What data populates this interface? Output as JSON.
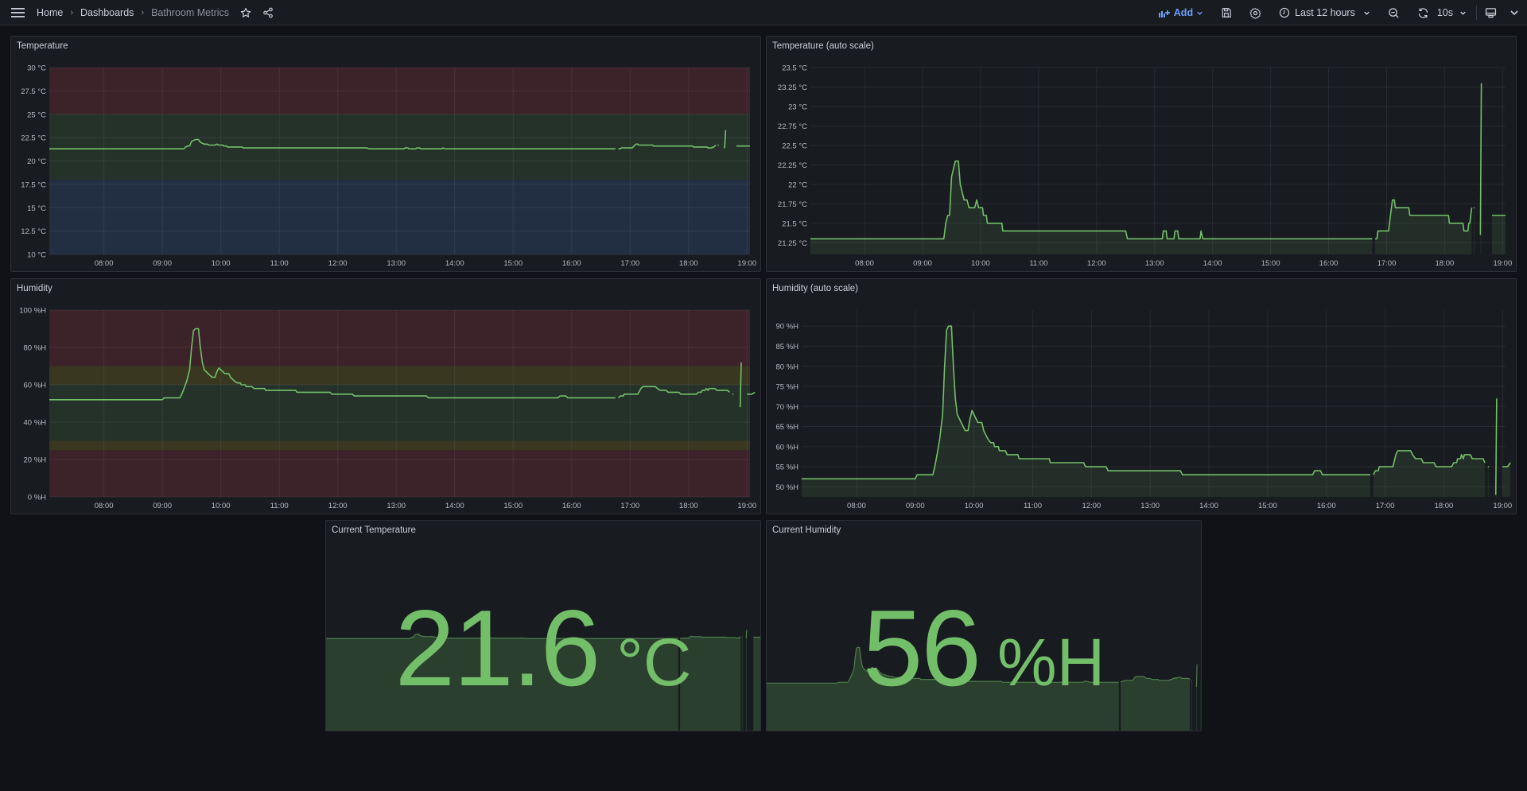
{
  "topbar": {
    "menu_icon": "hamburger-icon",
    "breadcrumbs": [
      "Home",
      "Dashboards",
      "Bathroom Metrics"
    ],
    "star_icon": "star-icon",
    "share_icon": "share-icon",
    "add_label": "Add",
    "save_icon": "save-icon",
    "settings_icon": "gear-icon",
    "time_range": "Last 12 hours",
    "zoom_out_icon": "zoom-out-icon",
    "refresh_icon": "refresh-icon",
    "refresh_interval": "10s",
    "tv_mode_icon": "monitor-icon"
  },
  "colors": {
    "accent": "#6e9fff",
    "series_green": "#73bf69",
    "threshold_red": "#f2495c",
    "threshold_green": "#73bf69",
    "threshold_blue": "#5794f2",
    "threshold_yellow": "#fade2a"
  },
  "panels": {
    "temperature": {
      "title": "Temperature"
    },
    "temperature_auto": {
      "title": "Temperature (auto scale)"
    },
    "humidity": {
      "title": "Humidity"
    },
    "humidity_auto": {
      "title": "Humidity (auto scale)"
    },
    "current_temperature": {
      "title": "Current Temperature",
      "value": "21.6",
      "unit": "°C"
    },
    "current_humidity": {
      "title": "Current Humidity",
      "value": "56",
      "unit": "%H"
    }
  },
  "chart_data": [
    {
      "id": "temperature",
      "type": "line",
      "title": "Temperature",
      "unit": "°C",
      "ylim": [
        10,
        30
      ],
      "yticks": [
        10,
        12.5,
        15,
        17.5,
        20,
        22.5,
        25,
        27.5,
        30
      ],
      "ytick_labels": [
        "10 °C",
        "12.5 °C",
        "15 °C",
        "17.5 °C",
        "20 °C",
        "22.5 °C",
        "25 °C",
        "27.5 °C",
        "30 °C"
      ],
      "xlim_minutes": [
        424,
        1143
      ],
      "xticks": [
        "08:00",
        "09:00",
        "10:00",
        "11:00",
        "12:00",
        "13:00",
        "14:00",
        "15:00",
        "16:00",
        "17:00",
        "18:00",
        "19:00"
      ],
      "thresholds": [
        {
          "from": 25,
          "to": 30,
          "color": "red"
        },
        {
          "from": 18,
          "to": 25,
          "color": "green"
        },
        {
          "from": 10,
          "to": 18,
          "color": "blue"
        }
      ],
      "series": "temperature",
      "fill": false,
      "grid": true
    },
    {
      "id": "temperature_auto",
      "type": "area",
      "title": "Temperature (auto scale)",
      "unit": "°C",
      "ylim": [
        21.1,
        23.5
      ],
      "yticks": [
        21.25,
        21.5,
        21.75,
        22,
        22.25,
        22.5,
        22.75,
        23,
        23.25,
        23.5
      ],
      "ytick_labels": [
        "21.25 °C",
        "21.5 °C",
        "21.75 °C",
        "22 °C",
        "22.25 °C",
        "22.5 °C",
        "22.75 °C",
        "23 °C",
        "23.25 °C",
        "23.5 °C"
      ],
      "xlim_minutes": [
        424,
        1143
      ],
      "xticks": [
        "08:00",
        "09:00",
        "10:00",
        "11:00",
        "12:00",
        "13:00",
        "14:00",
        "15:00",
        "16:00",
        "17:00",
        "18:00",
        "19:00"
      ],
      "series": "temperature",
      "fill": true,
      "grid": true
    },
    {
      "id": "humidity",
      "type": "line",
      "title": "Humidity",
      "unit": "%H",
      "ylim": [
        0,
        100
      ],
      "yticks": [
        0,
        20,
        40,
        60,
        80,
        100
      ],
      "ytick_labels": [
        "0 %H",
        "20 %H",
        "40 %H",
        "60 %H",
        "80 %H",
        "100 %H"
      ],
      "xlim_minutes": [
        424,
        1143
      ],
      "xticks": [
        "08:00",
        "09:00",
        "10:00",
        "11:00",
        "12:00",
        "13:00",
        "14:00",
        "15:00",
        "16:00",
        "17:00",
        "18:00",
        "19:00"
      ],
      "thresholds": [
        {
          "from": 70,
          "to": 100,
          "color": "red"
        },
        {
          "from": 60,
          "to": 70,
          "color": "yellow"
        },
        {
          "from": 30,
          "to": 60,
          "color": "green"
        },
        {
          "from": 25,
          "to": 30,
          "color": "yellow"
        },
        {
          "from": 0,
          "to": 25,
          "color": "red"
        }
      ],
      "series": "humidity",
      "fill": false,
      "grid": true
    },
    {
      "id": "humidity_auto",
      "type": "area",
      "title": "Humidity (auto scale)",
      "unit": "%H",
      "ylim": [
        47.5,
        94
      ],
      "yticks": [
        50,
        55,
        60,
        65,
        70,
        75,
        80,
        85,
        90
      ],
      "ytick_labels": [
        "50 %H",
        "55 %H",
        "60 %H",
        "65 %H",
        "70 %H",
        "75 %H",
        "80 %H",
        "85 %H",
        "90 %H"
      ],
      "xlim_minutes": [
        424,
        1143
      ],
      "xticks": [
        "08:00",
        "09:00",
        "10:00",
        "11:00",
        "12:00",
        "13:00",
        "14:00",
        "15:00",
        "16:00",
        "17:00",
        "18:00",
        "19:00"
      ],
      "series": "humidity",
      "fill": true,
      "grid": true
    },
    {
      "id": "current_temperature_spark",
      "type": "area",
      "series": "temperature",
      "ylim": [
        0,
        30
      ],
      "last_value": 21.6
    },
    {
      "id": "current_humidity_spark",
      "type": "area",
      "series": "humidity",
      "ylim": [
        0,
        140
      ],
      "last_value": 56
    }
  ],
  "series_data": {
    "temperature": [
      [
        [
          424,
          21.3
        ],
        [
          562,
          21.3
        ],
        [
          564,
          21.5
        ],
        [
          566,
          21.6
        ],
        [
          568,
          21.6
        ],
        [
          570,
          22.1
        ],
        [
          572,
          22.2
        ],
        [
          574,
          22.3
        ],
        [
          577,
          22.3
        ],
        [
          579,
          22.0
        ],
        [
          581,
          21.9
        ],
        [
          583,
          21.8
        ],
        [
          586,
          21.8
        ],
        [
          588,
          21.7
        ],
        [
          594,
          21.7
        ],
        [
          596,
          21.8
        ],
        [
          598,
          21.7
        ],
        [
          602,
          21.7
        ],
        [
          603,
          21.6
        ],
        [
          606,
          21.6
        ],
        [
          607,
          21.5
        ],
        [
          622,
          21.5
        ],
        [
          623,
          21.4
        ],
        [
          750,
          21.4
        ],
        [
          752,
          21.3
        ],
        [
          788,
          21.3
        ],
        [
          789,
          21.4
        ],
        [
          792,
          21.4
        ],
        [
          793,
          21.3
        ],
        [
          800,
          21.3
        ],
        [
          801,
          21.4
        ],
        [
          804,
          21.4
        ],
        [
          805,
          21.3
        ],
        [
          827,
          21.3
        ],
        [
          828,
          21.4
        ],
        [
          830,
          21.3
        ],
        [
          1005,
          21.3
        ]
      ],
      [
        [
          1008,
          21.3
        ],
        [
          1010,
          21.3
        ],
        [
          1011,
          21.4
        ],
        [
          1022,
          21.4
        ],
        [
          1023,
          21.5
        ],
        [
          1026,
          21.8
        ],
        [
          1028,
          21.8
        ],
        [
          1029,
          21.7
        ],
        [
          1043,
          21.7
        ],
        [
          1044,
          21.6
        ],
        [
          1084,
          21.6
        ],
        [
          1085,
          21.5
        ],
        [
          1099,
          21.5
        ],
        [
          1100,
          21.4
        ],
        [
          1104,
          21.4
        ],
        [
          1105,
          21.5
        ],
        [
          1106,
          21.5
        ],
        [
          1108,
          21.7
        ]
      ],
      [
        [
          1110,
          21.7
        ],
        [
          1111,
          21.7
        ]
      ],
      [
        [
          1117,
          21.35
        ],
        [
          1118,
          23.3
        ]
      ],
      [
        [
          1129,
          21.6
        ],
        [
          1143,
          21.6
        ]
      ]
    ],
    "humidity": [
      [
        [
          424,
          52
        ],
        [
          540,
          52
        ],
        [
          542,
          53
        ],
        [
          558,
          53
        ],
        [
          560,
          55
        ],
        [
          563,
          59
        ],
        [
          565,
          62
        ],
        [
          568,
          68
        ],
        [
          570,
          80
        ],
        [
          572,
          89
        ],
        [
          574,
          90
        ],
        [
          577,
          90
        ],
        [
          579,
          80
        ],
        [
          581,
          72
        ],
        [
          583,
          68
        ],
        [
          585,
          67
        ],
        [
          587,
          66
        ],
        [
          589,
          65
        ],
        [
          591,
          64
        ],
        [
          594,
          64
        ],
        [
          596,
          67
        ],
        [
          598,
          69
        ],
        [
          600,
          68
        ],
        [
          602,
          67
        ],
        [
          604,
          66
        ],
        [
          608,
          66
        ],
        [
          610,
          64
        ],
        [
          612,
          63
        ],
        [
          614,
          62
        ],
        [
          617,
          61
        ],
        [
          620,
          61
        ],
        [
          621,
          60
        ],
        [
          625,
          60
        ],
        [
          626,
          59
        ],
        [
          632,
          59
        ],
        [
          634,
          58
        ],
        [
          645,
          58
        ],
        [
          646,
          57
        ],
        [
          677,
          57
        ],
        [
          678,
          56
        ],
        [
          712,
          56
        ],
        [
          714,
          55
        ],
        [
          735,
          55
        ],
        [
          737,
          54
        ],
        [
          811,
          54
        ],
        [
          813,
          53
        ],
        [
          946,
          53
        ],
        [
          948,
          54
        ],
        [
          954,
          54
        ],
        [
          956,
          53
        ],
        [
          1005,
          53
        ]
      ],
      [
        [
          1008,
          53
        ],
        [
          1010,
          54
        ],
        [
          1013,
          54
        ],
        [
          1014,
          55
        ],
        [
          1028,
          55
        ],
        [
          1029,
          56
        ],
        [
          1031,
          58
        ],
        [
          1033,
          59
        ],
        [
          1046,
          59
        ],
        [
          1048,
          58
        ],
        [
          1051,
          57
        ],
        [
          1057,
          57
        ],
        [
          1059,
          56
        ],
        [
          1070,
          56
        ],
        [
          1072,
          55
        ],
        [
          1088,
          55
        ],
        [
          1090,
          56
        ],
        [
          1093,
          56
        ],
        [
          1094,
          57
        ],
        [
          1097,
          57
        ],
        [
          1098,
          58
        ],
        [
          1100,
          57
        ],
        [
          1101,
          58
        ],
        [
          1107,
          58
        ],
        [
          1109,
          57
        ],
        [
          1120,
          57
        ],
        [
          1122,
          56
        ]
      ],
      [
        [
          1125,
          55
        ],
        [
          1126,
          55
        ]
      ],
      [
        [
          1133,
          48
        ],
        [
          1134,
          72
        ]
      ],
      [
        [
          1140,
          55
        ],
        [
          1145,
          55
        ],
        [
          1148,
          56
        ]
      ]
    ]
  }
}
